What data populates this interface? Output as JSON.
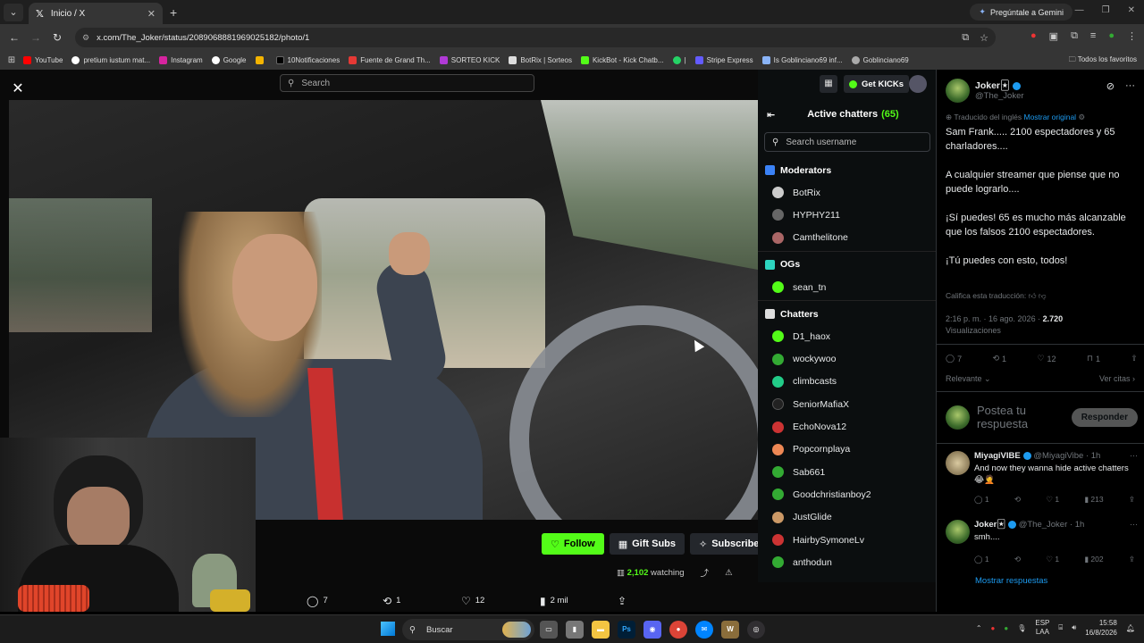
{
  "browser": {
    "tab_title": "Inicio / X",
    "gemini_label": "Pregúntale a Gemini",
    "url": "x.com/The_Joker/status/2089068881969025182/photo/1",
    "bookmarks": [
      "YouTube",
      "pretium iustum mat...",
      "Instagram",
      "Google",
      "",
      "10Notificaciones",
      "Fuente de Grand Th...",
      "SORTEO KICK",
      "BotRix | Sorteos",
      "KickBot - Kick Chatb...",
      "",
      "Stripe Express",
      "Is Goblinciano69 inf...",
      "Goblinciano69"
    ],
    "bookmarks_right": "Todos los favoritos"
  },
  "kick": {
    "search_placeholder": "Search",
    "get_kicks": "Get KICKs",
    "follow": "Follow",
    "gift_subs": "Gift Subs",
    "subscribe": "Subscribe",
    "watching_count": "2,102",
    "watching_label": "watching",
    "chatters_title": "Active chatters",
    "chatters_count": "(65)",
    "search_username": "Search username",
    "sections": {
      "moderators": "Moderators",
      "ogs": "OGs",
      "chatters": "Chatters"
    },
    "moderators": [
      "BotRix",
      "HYPHY211",
      "Camthelitone"
    ],
    "ogs": [
      "sean_tn"
    ],
    "chatters": [
      "D1_haox",
      "wockywoo",
      "climbcasts",
      "SeniorMafiaX",
      "EchoNova12",
      "Popcornplaya",
      "Sab661",
      "Goodchristianboy2",
      "JustGlide",
      "HairbySymoneLv",
      "anthodun"
    ]
  },
  "viewer_actions": {
    "replies": "7",
    "reposts": "1",
    "likes": "12",
    "views": "2 mil"
  },
  "tweet": {
    "name": "Joker🃏",
    "handle": "@The_Joker",
    "translated_from": "Traducido del inglés",
    "show_original": "Mostrar original",
    "body": [
      "Sam Frank..... 2100 espectadores y 65 charladores....",
      "A cualquier streamer que piense que no puede lograrlo....",
      "¡Sí puedes! 65 es mucho más alcanzable que los falsos 2100 espectadores.",
      "¡Tú puedes con esto, todos!"
    ],
    "rate_translation": "Califica esta traducción:",
    "time": "2:16 p. m. · 16 ago. 2026 ·",
    "views": "2.720",
    "views_label": "Visualizaciones",
    "replies": "7",
    "reposts": "1",
    "likes": "12",
    "bookmarks": "1",
    "relevant": "Relevante",
    "see_quotes": "Ver citas",
    "reply_placeholder": "Postea tu respuesta",
    "reply_button": "Responder"
  },
  "replies": [
    {
      "name": "MiyagiVIBE",
      "handle": "@MiyagiVibe · 1h",
      "text": "And now they wanna hide active chatters 😂🤦",
      "r": "1",
      "rt": "",
      "l": "1",
      "v": "213"
    },
    {
      "name": "Joker🃏",
      "handle": "@The_Joker · 1h",
      "text": "smh....",
      "r": "1",
      "rt": "",
      "l": "1",
      "v": "202"
    }
  ],
  "show_replies": "Mostrar respuestas",
  "taskbar": {
    "search": "Buscar",
    "lang_top": "ESP",
    "lang_bottom": "LAA",
    "time": "15:58",
    "date": "16/8/2026"
  }
}
